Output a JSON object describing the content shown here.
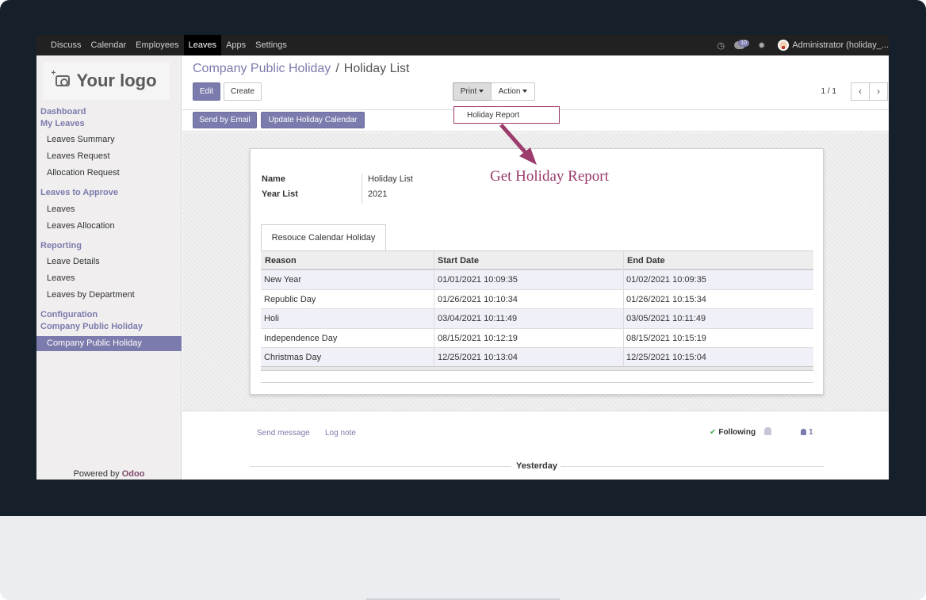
{
  "topbar": {
    "menu": [
      "Discuss",
      "Calendar",
      "Employees",
      "Leaves",
      "Apps",
      "Settings"
    ],
    "active": "Leaves",
    "message_count": "10",
    "user": "Administrator (holiday_..."
  },
  "sidebar": {
    "logo_text": "Your logo",
    "dashboard": "Dashboard",
    "my_leaves": "My Leaves",
    "my_leaves_items": [
      "Leaves Summary",
      "Leaves Request",
      "Allocation Request"
    ],
    "to_approve": "Leaves to Approve",
    "to_approve_items": [
      "Leaves",
      "Leaves Allocation"
    ],
    "reporting": "Reporting",
    "reporting_items": [
      "Leave Details",
      "Leaves",
      "Leaves by Department"
    ],
    "configuration": "Configuration",
    "config_group": "Company Public Holiday",
    "config_active": "Company Public Holiday",
    "powered_prefix": "Powered by",
    "powered_brand": "Odoo"
  },
  "breadcrumb": {
    "parent": "Company Public Holiday",
    "separator": "/",
    "current": "Holiday List"
  },
  "toolbar": {
    "edit": "Edit",
    "create": "Create",
    "print": "Print",
    "action": "Action",
    "pager": "1 / 1",
    "prev_icon": "chevron-left-icon",
    "next_icon": "chevron-right-icon"
  },
  "print_menu": {
    "items": [
      "Holiday Report"
    ]
  },
  "actions": {
    "send_email": "Send by Email",
    "update_calendar": "Update Holiday Calendar"
  },
  "annotation": "Get Holiday Report",
  "form": {
    "name_label": "Name",
    "name_value": "Holiday List",
    "year_label": "Year List",
    "year_value": "2021",
    "tab": "Resouce Calendar Holiday",
    "columns": [
      "Reason",
      "Start Date",
      "End Date"
    ],
    "rows": [
      [
        "New Year",
        "01/01/2021 10:09:35",
        "01/02/2021 10:09:35"
      ],
      [
        "Republic Day",
        "01/26/2021 10:10:34",
        "01/26/2021 10:15:34"
      ],
      [
        "Holi",
        "03/04/2021 10:11:49",
        "03/05/2021 10:11:49"
      ],
      [
        "Independence Day",
        "08/15/2021 10:12:19",
        "08/15/2021 10:15:19"
      ],
      [
        "Christmas Day",
        "12/25/2021 10:13:04",
        "12/25/2021 10:15:04"
      ]
    ]
  },
  "chatter": {
    "send_message": "Send message",
    "log_note": "Log note",
    "following": "Following",
    "followers": "1",
    "yesterday": "Yesterday"
  },
  "colors": {
    "primary": "#7c7bad",
    "annotation": "#9b3c6c",
    "topbar": "#212121",
    "bezel": "#15202b"
  }
}
